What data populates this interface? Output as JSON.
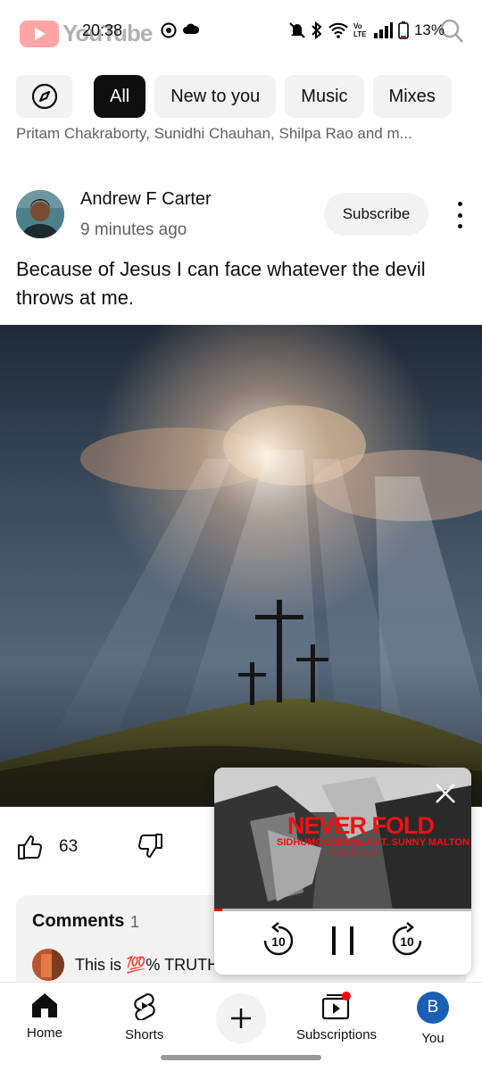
{
  "status_bar": {
    "app_ghost_logo": "YouTube",
    "time": "20:38",
    "battery": "13%",
    "network_label": "Vo LTE"
  },
  "chips": [
    {
      "label": "All",
      "active": true
    },
    {
      "label": "New to you",
      "active": false
    },
    {
      "label": "Music",
      "active": false
    },
    {
      "label": "Mixes",
      "active": false
    }
  ],
  "previous_item_text": "Pritam Chakraborty, Sunidhi Chauhan, Shilpa Rao and m...",
  "post": {
    "author": "Andrew F Carter",
    "time_ago": "9 minutes ago",
    "subscribe_label": "Subscribe",
    "text": "Because of Jesus I can face whatever the devil throws at me.",
    "like_count": "63"
  },
  "comments": {
    "title": "Comments",
    "count": "1",
    "top_comment": "This is 💯% TRUTH"
  },
  "mini_player": {
    "title_art": "NEVER FOLD",
    "subtitle_art": "SIDHUMOOSEWALA FT. SUNNY MALTON",
    "prod_art": "PROD BY CASH",
    "progress_fraction": 0.03,
    "rewind_seconds": "10",
    "forward_seconds": "10"
  },
  "bottom_nav": {
    "home": "Home",
    "shorts": "Shorts",
    "subscriptions": "Subscriptions",
    "you": "You",
    "you_initial": "B"
  },
  "colors": {
    "brand_red": "#ff0000",
    "chip_bg": "#f2f2f2",
    "active_chip": "#0f0f0f",
    "avatar_blue": "#1a5fb4"
  }
}
